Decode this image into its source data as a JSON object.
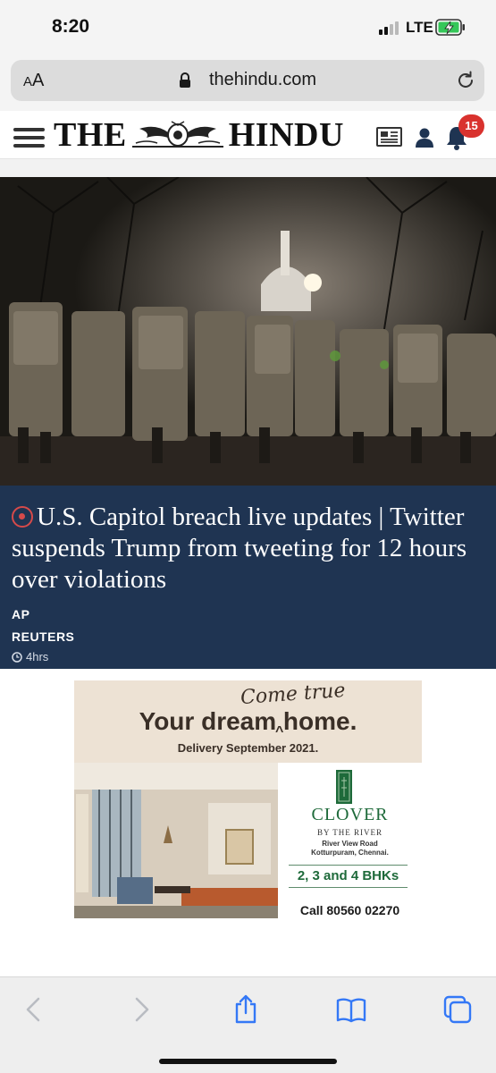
{
  "status_bar": {
    "time": "8:20",
    "network": "LTE",
    "battery": "charging"
  },
  "browser": {
    "text_size_small": "A",
    "text_size_large": "A",
    "url": "thehindu.com"
  },
  "site": {
    "logo_left": "THE",
    "logo_right": "HINDU",
    "notification_count": "15"
  },
  "article": {
    "headline": "U.S. Capitol breach live updates | Twitter suspends Trump from tweeting for 12 hours over violations",
    "authors": [
      "AP",
      "REUTERS"
    ],
    "time": "4hrs"
  },
  "ad": {
    "tagline_script": "Come true",
    "tagline_main": "Your dream home.",
    "caret": "^",
    "delivery": "Delivery September 2021.",
    "brand": "CLOVER",
    "brand_sub": "BY THE RIVER",
    "address_line1": "River View Road",
    "address_line2": "Kotturpuram, Chennai.",
    "configurations": "2, 3 and 4 BHKs",
    "call": "Call 80560 02270"
  },
  "colors": {
    "headline_bg": "#1f3452",
    "live_red": "#d64a4a",
    "badge_red": "#d9322e",
    "clover_green": "#1e6a3a",
    "toolbar_blue": "#3478f6"
  }
}
